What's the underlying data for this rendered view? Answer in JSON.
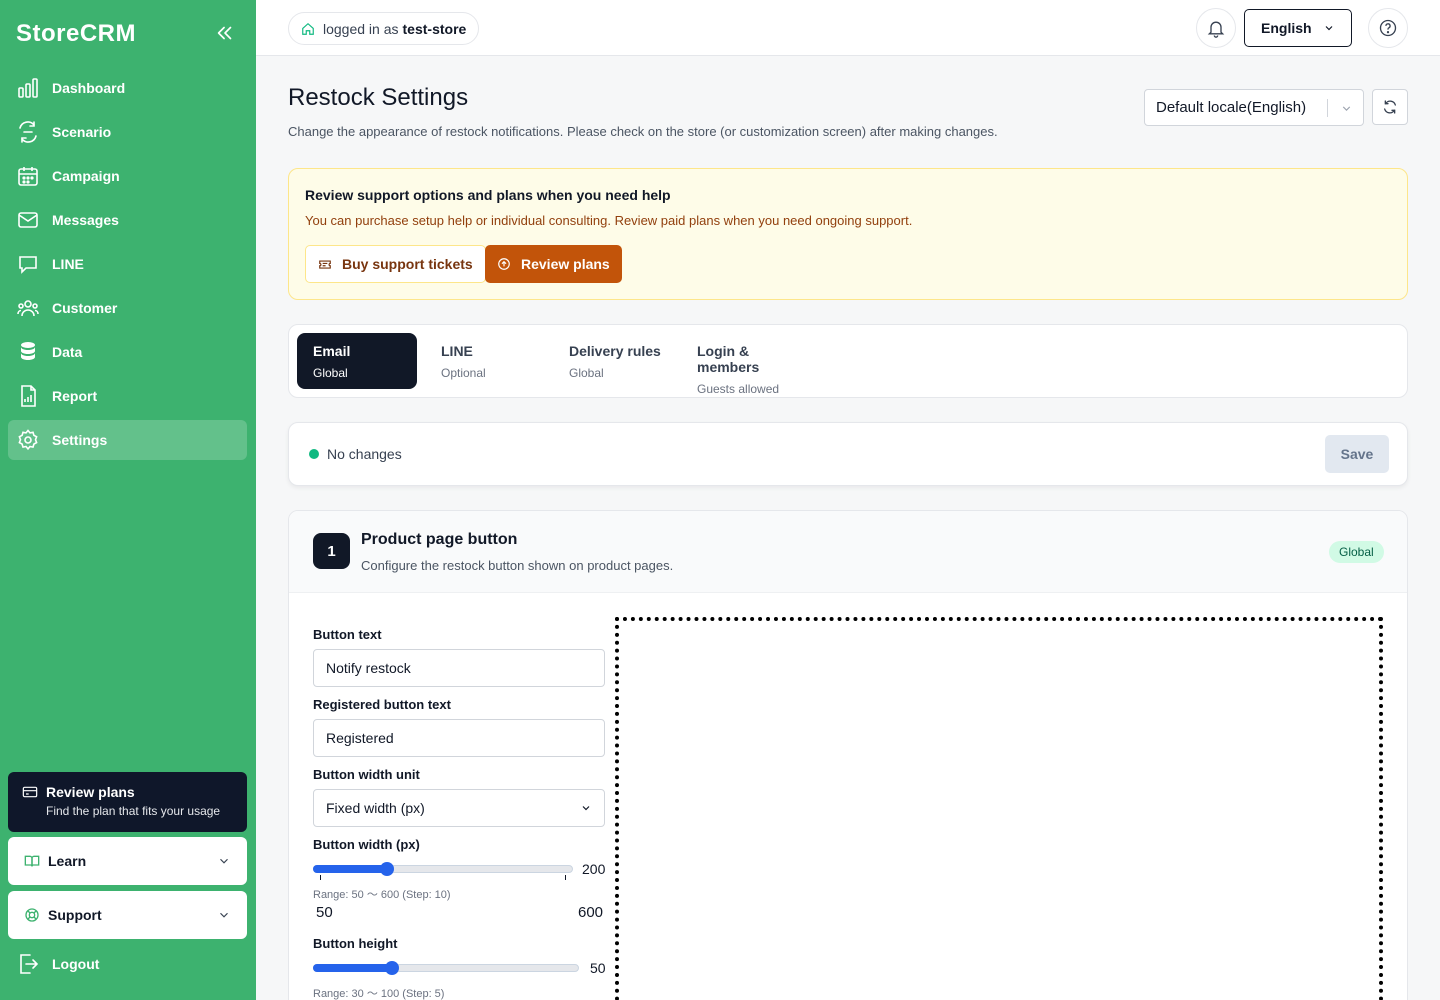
{
  "sidebar": {
    "brand": "StoreCRM",
    "items": [
      {
        "label": "Dashboard",
        "icon": "bar-chart-icon"
      },
      {
        "label": "Scenario",
        "icon": "scenario-icon"
      },
      {
        "label": "Campaign",
        "icon": "calendar-icon"
      },
      {
        "label": "Messages",
        "icon": "mail-icon"
      },
      {
        "label": "LINE",
        "icon": "chat-icon"
      },
      {
        "label": "Customer",
        "icon": "users-icon"
      },
      {
        "label": "Data",
        "icon": "database-icon"
      },
      {
        "label": "Report",
        "icon": "report-icon"
      },
      {
        "label": "Settings",
        "icon": "gear-icon",
        "active": true
      }
    ],
    "plan_title": "Review plans",
    "plan_sub": "Find the plan that fits your usage",
    "learn": "Learn",
    "support": "Support",
    "logout": "Logout"
  },
  "topbar": {
    "login_prefix": "logged in as",
    "store": "test-store",
    "language": "English"
  },
  "page": {
    "title": "Restock Settings",
    "subtitle": "Change the appearance of restock notifications. Please check on the store (or customization screen) after making changes.",
    "locale": "Default locale(English)"
  },
  "notice": {
    "heading": "Review support options and plans when you need help",
    "body": "You can purchase setup help or individual consulting. Review paid plans when you need ongoing support.",
    "buy_label": "Buy support tickets",
    "plans_label": "Review plans"
  },
  "tabs": [
    {
      "label": "Email",
      "sub": "Global"
    },
    {
      "label": "LINE",
      "sub": "Optional"
    },
    {
      "label": "Delivery rules",
      "sub": "Global"
    },
    {
      "label": "Login & members",
      "sub": "Guests allowed"
    }
  ],
  "status": {
    "text": "No changes",
    "save": "Save"
  },
  "section": {
    "number": "1",
    "title": "Product page button",
    "subtitle": "Configure the restock button shown on product pages.",
    "badge": "Global"
  },
  "form": {
    "button_text_label": "Button text",
    "button_text_value": "Notify restock",
    "registered_label": "Registered button text",
    "registered_value": "Registered",
    "width_unit_label": "Button width unit",
    "width_unit_value": "Fixed width (px)",
    "width_label": "Button width (px)",
    "width_value": 200,
    "width_range": "Range: 50 〜 600   (Step: 10)",
    "width_min": 50,
    "width_max": 600,
    "height_label": "Button height",
    "height_value": 50,
    "height_range": "Range: 30 〜 100   (Step: 5)",
    "height_min": 30,
    "height_max": 100
  }
}
